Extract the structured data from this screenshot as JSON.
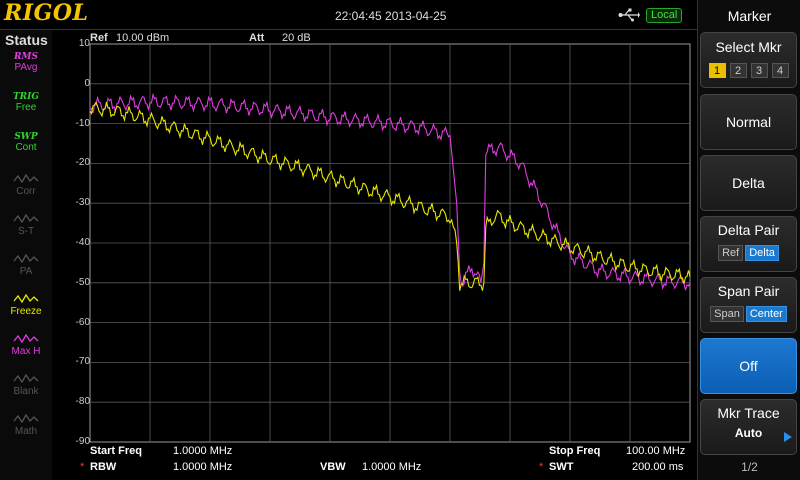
{
  "brand": "RIGOL",
  "timestamp": "22:04:45 2013-04-25",
  "remote_status": "Local",
  "status_panel": {
    "title": "Status",
    "items": [
      {
        "top": "RMS",
        "label": "PAvg",
        "color": "#e13ce1",
        "enabled": true
      },
      {
        "top": "TRIG",
        "label": "Free",
        "color": "#2fd62f",
        "enabled": true
      },
      {
        "top": "SWP",
        "label": "Cont",
        "color": "#2fd62f",
        "enabled": true
      },
      {
        "top": "",
        "label": "Corr",
        "color": "#555555",
        "enabled": false
      },
      {
        "top": "",
        "label": "S-T",
        "color": "#555555",
        "enabled": false
      },
      {
        "top": "",
        "label": "PA",
        "color": "#555555",
        "enabled": false
      },
      {
        "top": "",
        "label": "Freeze",
        "color": "#e8e800",
        "enabled": true
      },
      {
        "top": "",
        "label": "Max H",
        "color": "#e13ce1",
        "enabled": true
      },
      {
        "top": "",
        "label": "Blank",
        "color": "#555555",
        "enabled": false
      },
      {
        "top": "",
        "label": "Math",
        "color": "#555555",
        "enabled": false
      }
    ]
  },
  "header": {
    "ref_label": "Ref",
    "ref_value": "10.00 dBm",
    "att_label": "Att",
    "att_value": "20 dB"
  },
  "footer": {
    "start_label": "Start Freq",
    "start_value": "1.0000 MHz",
    "stop_label": "Stop Freq",
    "stop_value": "100.00 MHz",
    "rbw_label": "RBW",
    "rbw_value": "1.0000 MHz",
    "vbw_label": "VBW",
    "vbw_value": "1.0000 MHz",
    "swt_label": "SWT",
    "swt_value": "200.00 ms",
    "coupled_marker": "*"
  },
  "menu": {
    "title": "Marker",
    "select_mkr": {
      "label": "Select Mkr",
      "options": [
        "1",
        "2",
        "3",
        "4"
      ],
      "selected": "1"
    },
    "normal": "Normal",
    "delta": "Delta",
    "delta_pair": {
      "label": "Delta Pair",
      "options": [
        "Ref",
        "Delta"
      ],
      "selected": "Delta"
    },
    "span_pair": {
      "label": "Span Pair",
      "options": [
        "Span",
        "Center"
      ],
      "selected": "Center"
    },
    "off": "Off",
    "mkr_trace": {
      "label": "Mkr Trace",
      "value": "Auto"
    },
    "page": "1/2"
  },
  "chart_data": {
    "type": "line",
    "x_unit": "MHz",
    "y_unit": "dBm",
    "xlim": [
      1.0,
      100.0
    ],
    "ylim": [
      -90,
      10
    ],
    "y_ticks": [
      10,
      0,
      -10,
      -20,
      -30,
      -40,
      -50,
      -60,
      -70,
      -80,
      -90
    ],
    "x_divisions": 10,
    "grid": true,
    "series": [
      {
        "color": "#e13ce1",
        "x": [
          1.0,
          5.95,
          10.9,
          20.8,
          30.7,
          40.6,
          50.5,
          55.45,
          60.4,
          61.5,
          62.0,
          62.5,
          64.0,
          65.5,
          66.0,
          66.3,
          68.5,
          72.0,
          75.0,
          78.0,
          80.2,
          85.0,
          90.0,
          95.0,
          100.0
        ],
        "y": [
          -5.5,
          -5.0,
          -4.5,
          -5.0,
          -6.5,
          -8.5,
          -10.0,
          -11.0,
          -13.0,
          -30.0,
          -47.0,
          -50.0,
          -46.0,
          -50.0,
          -45.0,
          -17.0,
          -16.0,
          -20.0,
          -28.0,
          -37.0,
          -43.0,
          -47.0,
          -48.5,
          -49.5,
          -50.0
        ]
      },
      {
        "color": "#e8e800",
        "x": [
          1.0,
          5.95,
          10.9,
          15.85,
          20.8,
          25.75,
          30.7,
          35.65,
          40.6,
          45.55,
          50.5,
          55.45,
          60.4,
          61.5,
          62.0,
          66.0,
          66.3,
          68.0,
          70.3,
          75.0,
          80.2,
          85.0,
          90.0,
          95.0,
          100.0
        ],
        "y": [
          -6.0,
          -7.0,
          -9.0,
          -11.5,
          -14.0,
          -16.5,
          -19.0,
          -21.0,
          -23.5,
          -26.0,
          -28.5,
          -31.0,
          -33.5,
          -40.0,
          -50.0,
          -50.0,
          -36.0,
          -33.0,
          -35.0,
          -38.0,
          -41.0,
          -43.5,
          -46.0,
          -47.5,
          -48.5
        ]
      }
    ]
  }
}
